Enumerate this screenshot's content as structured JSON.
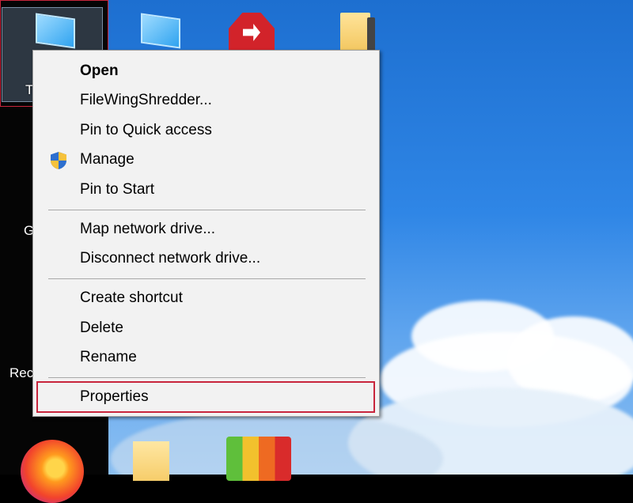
{
  "desktop": {
    "icons": [
      {
        "name": "this-pc-icon",
        "label": "T"
      },
      {
        "name": "monitor-icon-2"
      },
      {
        "name": "red-app-icon"
      },
      {
        "name": "folder-icon"
      },
      {
        "name": "g-item",
        "label": "G"
      },
      {
        "name": "recycle-bin",
        "label": "Rec"
      }
    ],
    "taskbar_like": [
      "firefox-icon",
      "document-icon",
      "avg-icon"
    ]
  },
  "context_menu": {
    "items": [
      {
        "label": "Open",
        "bold": true
      },
      {
        "label": "FileWingShredder..."
      },
      {
        "label": "Pin to Quick access"
      },
      {
        "label": "Manage",
        "icon": "shield-icon"
      },
      {
        "label": "Pin to Start"
      },
      {
        "label": "Map network drive..."
      },
      {
        "label": "Disconnect network drive..."
      },
      {
        "label": "Create shortcut"
      },
      {
        "label": "Delete"
      },
      {
        "label": "Rename"
      },
      {
        "label": "Properties",
        "highlighted": true
      }
    ]
  },
  "colors": {
    "highlight": "#c8253c",
    "menu_bg": "#f2f2f2",
    "separator": "#a8a8a8"
  }
}
